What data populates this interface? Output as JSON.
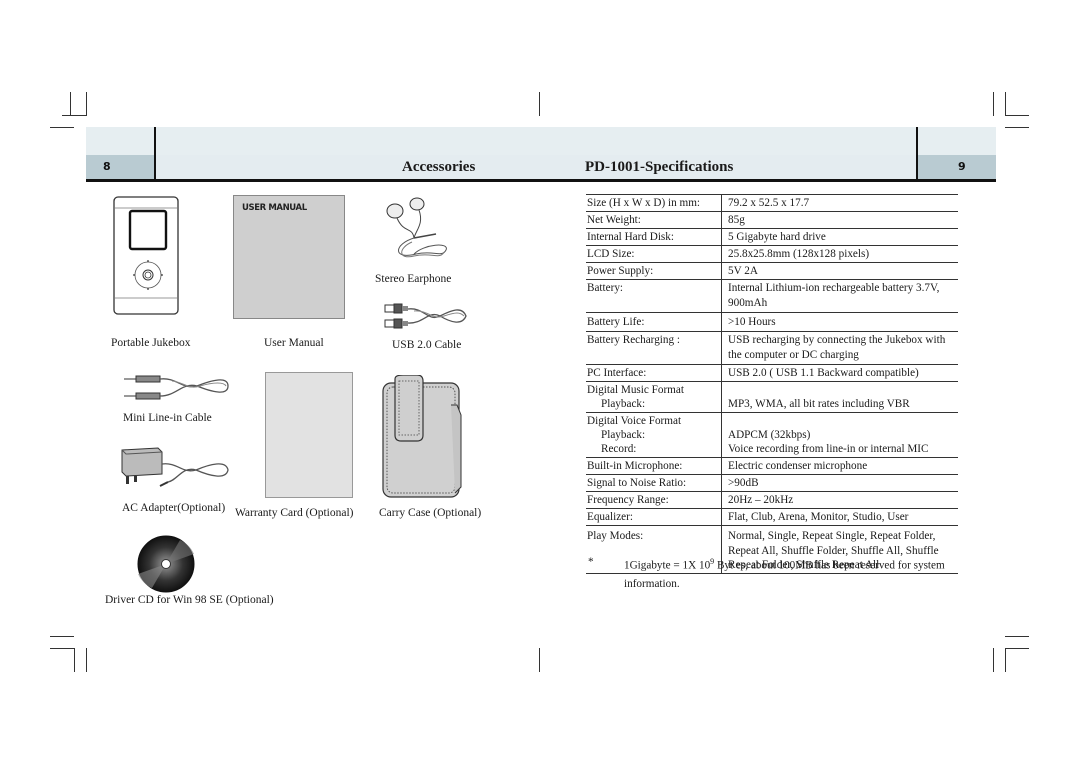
{
  "header": {
    "left_page_number": "8",
    "right_page_number": "9",
    "left_title": "Accessories",
    "right_title": "PD-1001-Specifications"
  },
  "accessories": {
    "items": [
      {
        "label": "Portable Jukebox",
        "icon": "jukebox-icon"
      },
      {
        "label": "User Manual",
        "icon": "manual-icon",
        "cover_text": "USER MANUAL"
      },
      {
        "label": "Stereo Earphone",
        "icon": "earphone-icon"
      },
      {
        "label": "USB 2.0 Cable",
        "icon": "usb-cable-icon"
      },
      {
        "label": "Mini Line-in Cable",
        "icon": "line-in-cable-icon"
      },
      {
        "label": "AC Adapter(Optional)",
        "icon": "ac-adapter-icon"
      },
      {
        "label": "Warranty Card (Optional)",
        "icon": "warranty-card-icon"
      },
      {
        "label": "Carry Case (Optional)",
        "icon": "carry-case-icon"
      },
      {
        "label": "Driver CD for Win 98 SE (Optional)",
        "icon": "cd-icon"
      }
    ]
  },
  "specs": {
    "rows": [
      {
        "label": "Size (H x W x D) in mm:",
        "value": "79.2 x 52.5 x 17.7"
      },
      {
        "label": "Net Weight:",
        "value": "85g"
      },
      {
        "label": "Internal Hard Disk:",
        "value": "5 Gigabyte hard drive"
      },
      {
        "label": "LCD Size:",
        "value": "25.8x25.8mm (128x128 pixels)"
      },
      {
        "label": "Power Supply:",
        "value": "5V 2A"
      },
      {
        "label": "Battery:",
        "value": "Internal Lithium-ion rechargeable battery 3.7V,",
        "value2": "900mAh"
      },
      {
        "label": "Battery Life:",
        "value": ">10 Hours"
      },
      {
        "label": "Battery Recharging :",
        "value": "USB recharging by connecting the Jukebox with",
        "value2": "the computer or DC charging"
      },
      {
        "label": "PC Interface:",
        "value": "USB 2.0 ( USB 1.1 Backward compatible)"
      },
      {
        "label": "Digital Music Format",
        "sub1": "Playback:",
        "value": "",
        "value2": "MP3, WMA, all bit rates including VBR"
      },
      {
        "label": "Digital Voice Format",
        "sub1": "Playback:",
        "sub2": "Record:",
        "value": "",
        "value2": "ADPCM (32kbps)",
        "value3": "Voice recording from line-in or internal MIC"
      },
      {
        "label": "Built-in Microphone:",
        "value": "Electric condenser microphone"
      },
      {
        "label": "Signal to Noise Ratio:",
        "value": ">90dB"
      },
      {
        "label": "Frequency Range:",
        "value": "20Hz – 20kHz"
      },
      {
        "label": "Equalizer:",
        "value": "Flat, Club, Arena, Monitor, Studio, User"
      },
      {
        "label": "Play Modes:",
        "value": "Normal, Single, Repeat Single, Repeat Folder,",
        "value2": "Repeat All, Shuffle Folder, Shuffle All, Shuffle",
        "value3": "Repeat Folder, Shuffle Repeat All"
      }
    ],
    "footnote": {
      "marker": "*",
      "text_before_sup": "1Gigabyte = 1X 10",
      "sup": "9",
      "text_after_sup": " Byt es, about 100MB has been reserved for system",
      "text_line2": "information."
    }
  }
}
